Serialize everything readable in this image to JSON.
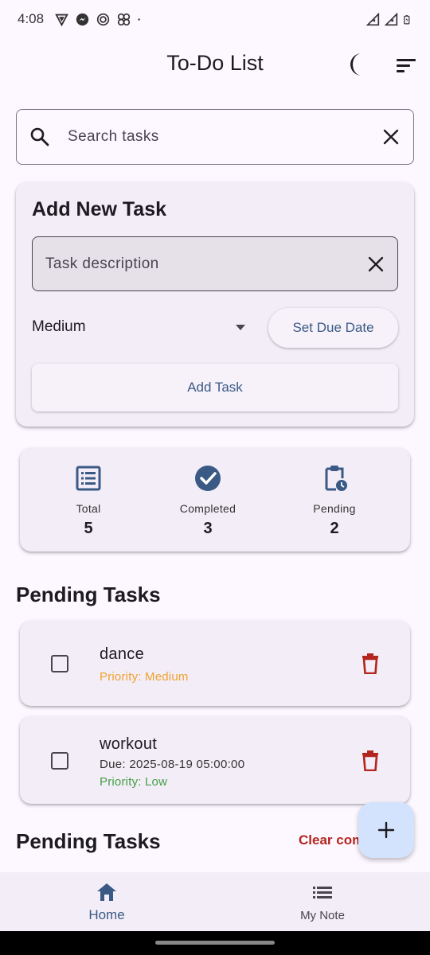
{
  "status_bar": {
    "time": "4:08"
  },
  "app_bar": {
    "title": "To-Do List",
    "theme_icon": "moon-icon",
    "sort_icon": "sort-icon"
  },
  "search": {
    "placeholder": "Search tasks",
    "value": ""
  },
  "add_task": {
    "heading": "Add New Task",
    "description_placeholder": "Task description",
    "priority": "Medium",
    "due_button": "Set Due Date",
    "add_button": "Add Task"
  },
  "stats": {
    "total": {
      "label": "Total",
      "value": "5"
    },
    "completed": {
      "label": "Completed",
      "value": "3"
    },
    "pending": {
      "label": "Pending",
      "value": "2"
    }
  },
  "pending_section": {
    "title": "Pending Tasks"
  },
  "tasks": [
    {
      "title": "dance",
      "due": "",
      "priority": "Priority: Medium",
      "priority_color": "#f0a22e",
      "checked": false
    },
    {
      "title": "workout",
      "due": "Due: 2025-08-19 05:00:00",
      "priority": "Priority: Low",
      "priority_color": "#43a047",
      "checked": false
    }
  ],
  "second_section": {
    "title": "Pending Tasks",
    "action": "Clear com"
  },
  "bottom_nav": {
    "items": [
      {
        "label": "Home",
        "icon": "home-icon",
        "active": true
      },
      {
        "label": "My Note",
        "icon": "list-icon",
        "active": false
      }
    ]
  },
  "colors": {
    "primary": "#3a5a85",
    "danger": "#b3261e",
    "surface": "#f3edf7",
    "background": "#fdf7ff"
  }
}
